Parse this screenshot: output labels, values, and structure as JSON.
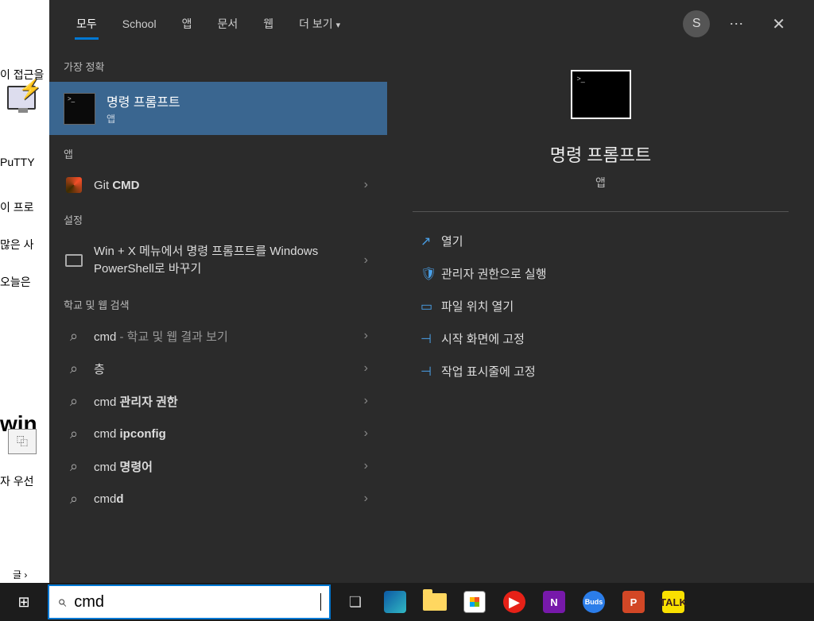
{
  "background": {
    "t1": "이 접근을",
    "putty_label": "PuTTY",
    "t2": "이 프로",
    "t3": "많은 사",
    "t4": "오늘은 ",
    "bold": "win",
    "t5": "자 우선",
    "gul": "글 ›",
    "copy_icon_glyph": "⿻"
  },
  "tabs": {
    "all": "모두",
    "school": "School",
    "apps": "앱",
    "docs": "문서",
    "web": "웹",
    "more": "더 보기",
    "more_chevron": "▾"
  },
  "header": {
    "user_initial": "S",
    "ellipsis": "⋯",
    "close": "✕"
  },
  "left": {
    "best_match_header": "가장 정확",
    "best_match": {
      "title": "명령 프롬프트",
      "subtitle": "앱"
    },
    "apps_header": "앱",
    "git_cmd_prefix": "Git ",
    "git_cmd_bold": "CMD",
    "settings_header": "설정",
    "powershell_line": "Win + X 메뉴에서 명령 프롬프트를 Windows PowerShell로 바꾸기",
    "school_web_header": "학교 및 웹 검색",
    "suggestions": [
      {
        "prefix": "cmd",
        "suffix": " - 학교 및 웹 결과 보기"
      },
      {
        "prefix": "층",
        "suffix": ""
      },
      {
        "prefix": "cmd ",
        "bold": "관리자 권한"
      },
      {
        "prefix": "cmd ",
        "bold": "ipconfig"
      },
      {
        "prefix": "cmd ",
        "bold": "명령어"
      },
      {
        "prefix": "cmd",
        "bold": "d"
      }
    ],
    "chevron": "›"
  },
  "preview": {
    "title": "명령 프롬프트",
    "subtitle": "앱",
    "actions": [
      {
        "icon": "↗",
        "label": "열기"
      },
      {
        "icon": "🛡",
        "label": "관리자 권한으로 실행"
      },
      {
        "icon": "▭",
        "label": "파일 위치 열기"
      },
      {
        "icon": "⊣",
        "label": "시작 화면에 고정"
      },
      {
        "icon": "⊣",
        "label": "작업 표시줄에 고정"
      }
    ]
  },
  "taskbar": {
    "search_value": "cmd",
    "start_glyph": "⊞",
    "search_glyph": "⌕",
    "taskview_glyph": "❏",
    "onen_label": "N",
    "buds_label": "Buds",
    "ppt_label": "P",
    "kakao_label": "TALK",
    "ytm_tri": "▶"
  }
}
